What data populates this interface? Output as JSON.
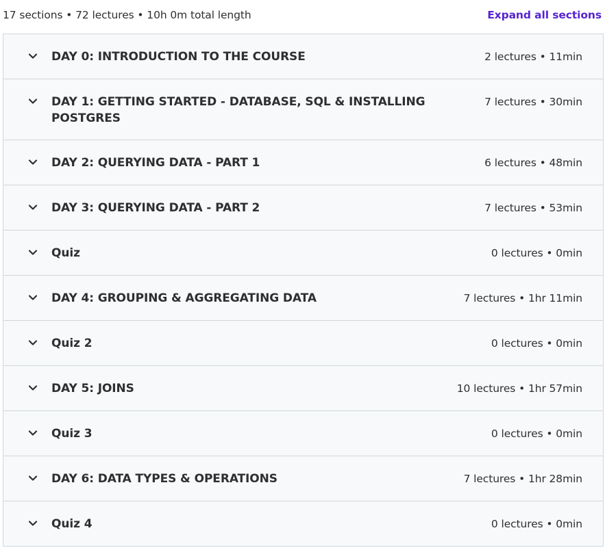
{
  "header": {
    "summary": "17 sections • 72 lectures • 10h 0m total length",
    "expand_label": "Expand all sections"
  },
  "colors": {
    "accent": "#5624d0",
    "text": "#2d2f31",
    "section_bg": "#f7f9fa",
    "border": "#d1d7dc"
  },
  "sections": [
    {
      "title": "DAY 0: INTRODUCTION TO THE COURSE",
      "meta": "2 lectures • 11min",
      "icon": "chevron-down-icon"
    },
    {
      "title": "DAY 1: GETTING STARTED - DATABASE, SQL & INSTALLING POSTGRES",
      "meta": "7 lectures • 30min",
      "icon": "chevron-down-icon"
    },
    {
      "title": "DAY 2: QUERYING DATA - PART 1",
      "meta": "6 lectures • 48min",
      "icon": "chevron-down-icon"
    },
    {
      "title": "DAY 3: QUERYING DATA - PART 2",
      "meta": "7 lectures • 53min",
      "icon": "chevron-down-icon"
    },
    {
      "title": "Quiz",
      "meta": "0 lectures • 0min",
      "icon": "chevron-down-icon"
    },
    {
      "title": "DAY 4: GROUPING & AGGREGATING DATA",
      "meta": "7 lectures • 1hr 11min",
      "icon": "chevron-down-icon"
    },
    {
      "title": "Quiz 2",
      "meta": "0 lectures • 0min",
      "icon": "chevron-down-icon"
    },
    {
      "title": "DAY 5: JOINS",
      "meta": "10 lectures • 1hr 57min",
      "icon": "chevron-down-icon"
    },
    {
      "title": "Quiz 3",
      "meta": "0 lectures • 0min",
      "icon": "chevron-down-icon"
    },
    {
      "title": "DAY 6: DATA TYPES & OPERATIONS",
      "meta": "7 lectures • 1hr 28min",
      "icon": "chevron-down-icon"
    },
    {
      "title": "Quiz 4",
      "meta": "0 lectures • 0min",
      "icon": "chevron-down-icon"
    }
  ]
}
